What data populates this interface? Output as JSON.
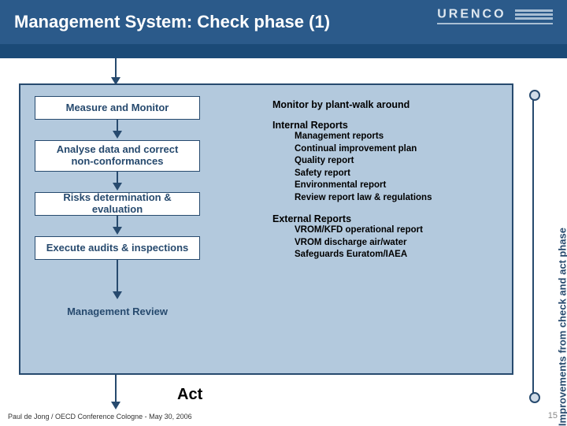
{
  "header": {
    "title": "Management System: Check phase (1)",
    "logo_text": "URENCO"
  },
  "left_boxes": {
    "b1": "Measure and Monitor",
    "b2": "Analyse data and correct\nnon-conformances",
    "b3": "Risks determination & evaluation",
    "b4": "Execute audits & inspections",
    "b5": "Management Review"
  },
  "right": {
    "monitor": "Monitor by plant-walk around",
    "internal_h": "Internal Reports",
    "internal": [
      "Management reports",
      "Continual improvement plan",
      "Quality report",
      "Safety report",
      "Environmental report",
      "Review report law & regulations"
    ],
    "external_h": "External Reports",
    "external": [
      "VROM/KFD operational report",
      "VROM discharge air/water",
      "Safeguards Euratom/IAEA"
    ]
  },
  "side_label": "Improvements from check and act phase",
  "act_label": "Act",
  "footer": "Paul de Jong / OECD Conference Cologne - May 30, 2006",
  "page_number": "15"
}
